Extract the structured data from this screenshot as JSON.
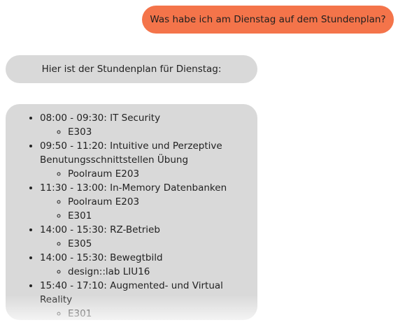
{
  "chat": {
    "user_message": "Was habe ich am Dienstag auf dem Stundenplan?",
    "bot_intro": "Hier ist der Stundenplan für Dienstag:",
    "schedule": [
      {
        "label": "08:00 - 09:30: IT Security",
        "rooms": [
          "E303"
        ]
      },
      {
        "label": "09:50 - 11:20: Intuitive und Perzeptive Benutungsschnittstellen Übung",
        "rooms": [
          "Poolraum E203"
        ]
      },
      {
        "label": "11:30 - 13:00: In-Memory Datenbanken",
        "rooms": [
          "Poolraum E203",
          "E301"
        ]
      },
      {
        "label": "14:00 - 15:30: RZ-Betrieb",
        "rooms": [
          "E305"
        ]
      },
      {
        "label": "14:00 - 15:30: Bewegtbild",
        "rooms": [
          "design::lab LIU16"
        ]
      },
      {
        "label": "15:40 - 17:10: Augmented- und Virtual Reality",
        "rooms": [
          "E301"
        ]
      }
    ]
  },
  "colors": {
    "user_bubble": "#f4744a",
    "bot_bubble": "#d9d9d9",
    "background": "#ffffff"
  }
}
